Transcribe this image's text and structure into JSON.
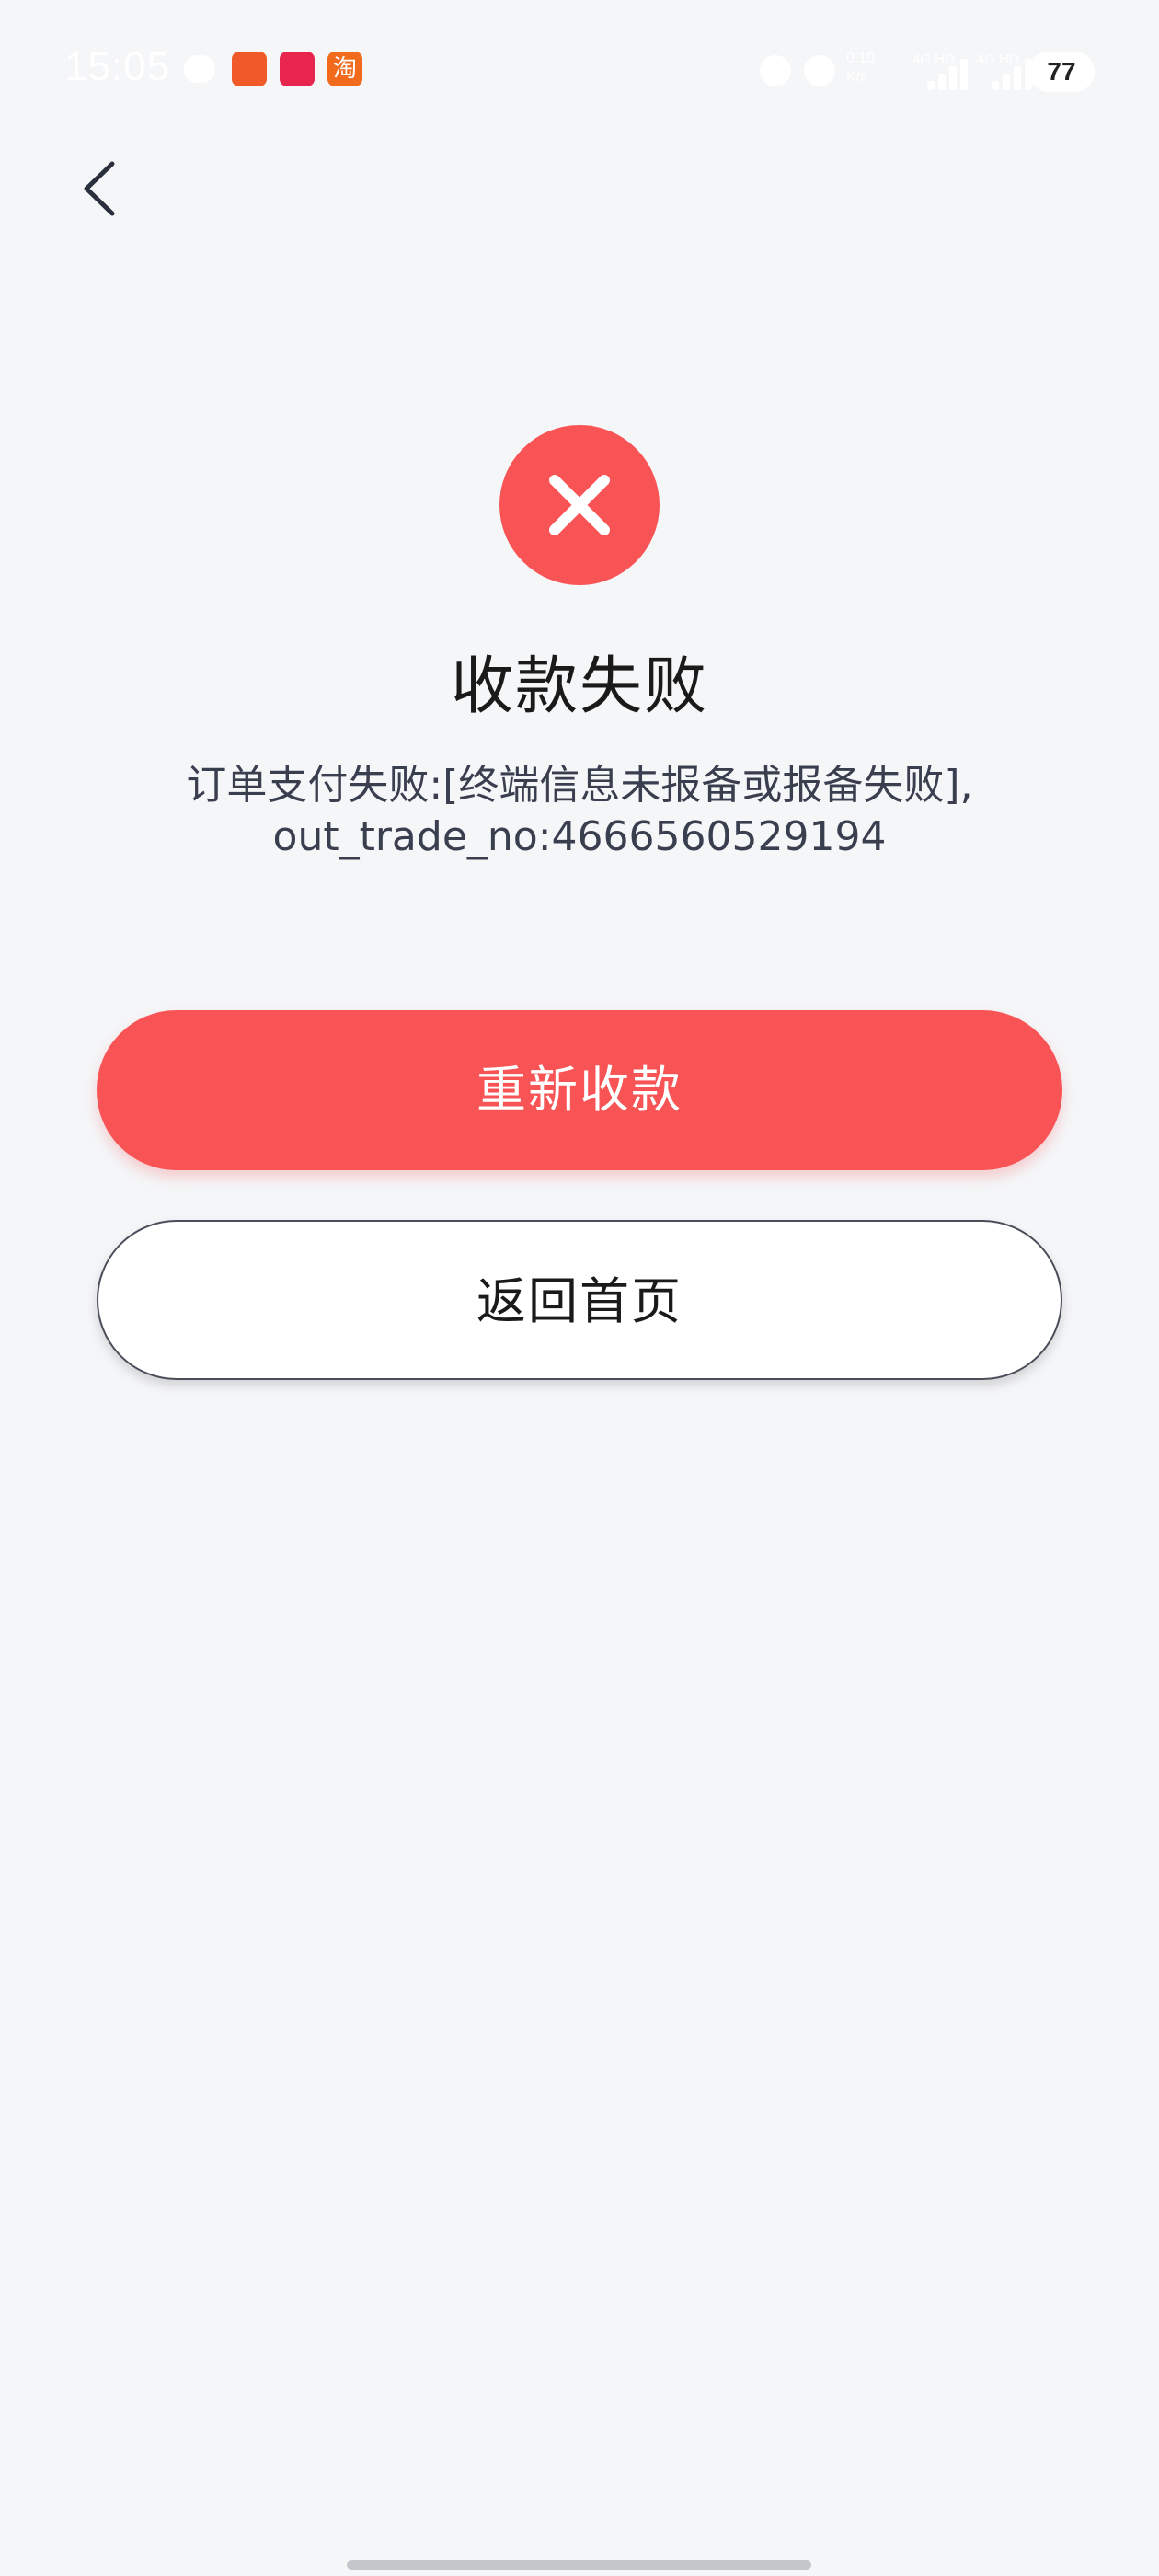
{
  "status_bar": {
    "time": "15:05",
    "notif_app3_label": "淘",
    "net_speed": "0.10\nK/s",
    "signal1_label": "4G HD",
    "signal2_label": "4G HD",
    "battery": "77"
  },
  "icons": {
    "back": "chevron-left-icon",
    "fail": "close-circle-icon"
  },
  "colors": {
    "accent": "#f85355",
    "background": "#f5f6f8",
    "text": "#1a1a1a",
    "message": "#3a3f50"
  },
  "result": {
    "title": "收款失败",
    "message": "订单支付失败:[终端信息未报备或报备失败],out_trade_no:4666560529194"
  },
  "actions": {
    "retry_label": "重新收款",
    "home_label": "返回首页"
  }
}
